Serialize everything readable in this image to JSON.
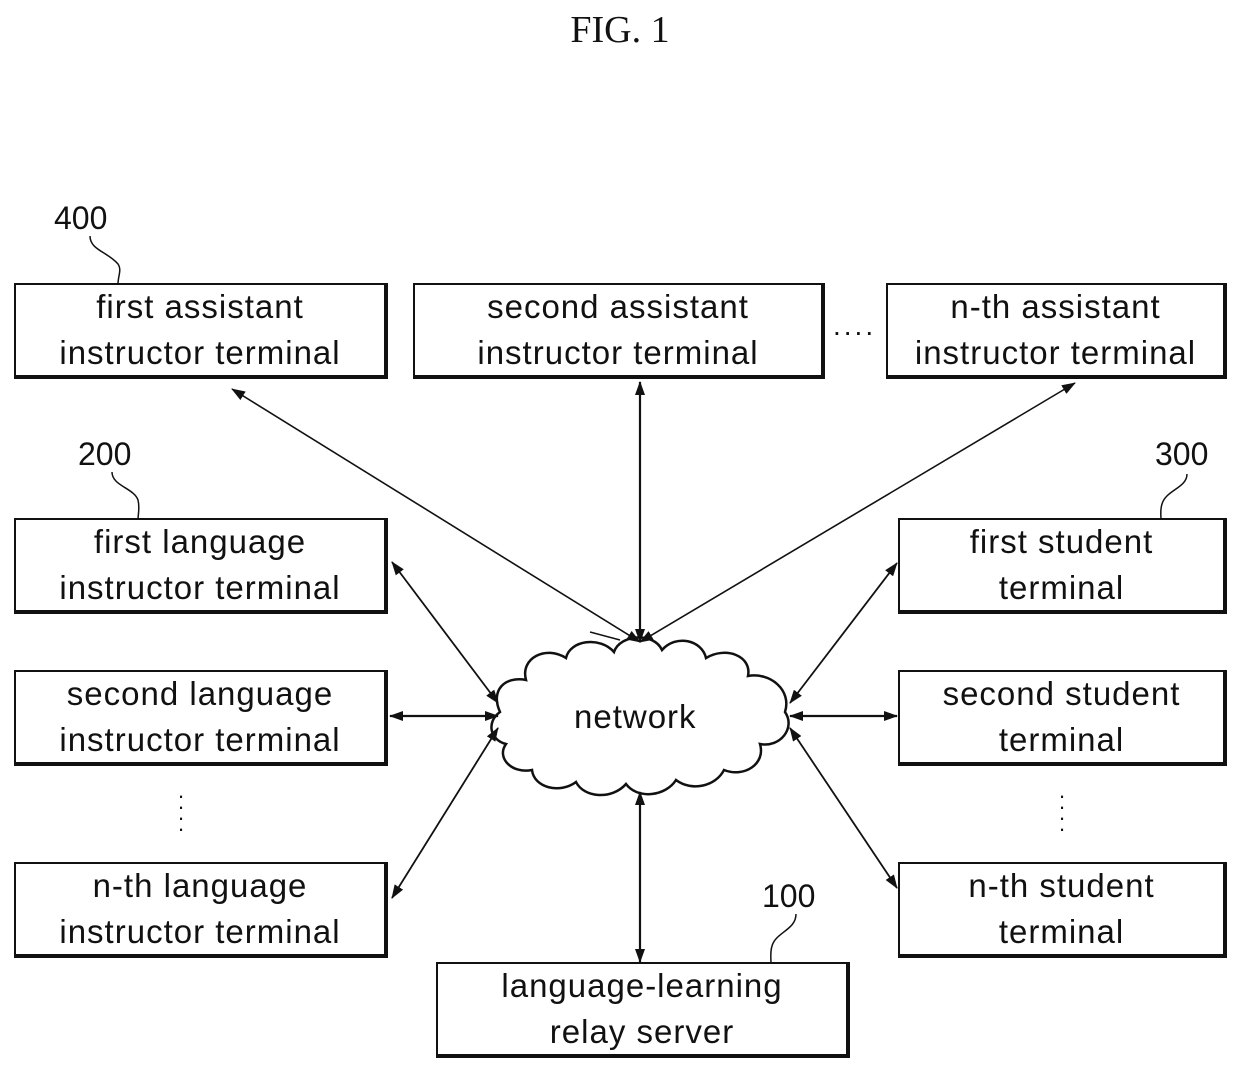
{
  "figure": {
    "title": "FIG. 1",
    "network_label": "network",
    "refs": {
      "assistant": "400",
      "language_instructor": "200",
      "student": "300",
      "server": "100"
    },
    "assistant_terminals": [
      {
        "line1": "first assistant",
        "line2": "instructor terminal"
      },
      {
        "line1": "second assistant",
        "line2": "instructor terminal"
      },
      {
        "line1": "n-th assistant",
        "line2": "instructor terminal"
      }
    ],
    "language_instructor_terminals": [
      {
        "line1": "first language",
        "line2": "instructor terminal"
      },
      {
        "line1": "second language",
        "line2": "instructor terminal"
      },
      {
        "line1": "n-th language",
        "line2": "instructor terminal"
      }
    ],
    "student_terminals": [
      {
        "line1": "first student",
        "line2": "terminal"
      },
      {
        "line1": "second student",
        "line2": "terminal"
      },
      {
        "line1": "n-th student",
        "line2": "terminal"
      }
    ],
    "server": {
      "line1": "language-learning",
      "line2": "relay server"
    },
    "ellipsis_horizontal": "....",
    "ellipsis_vertical": "⋮"
  }
}
